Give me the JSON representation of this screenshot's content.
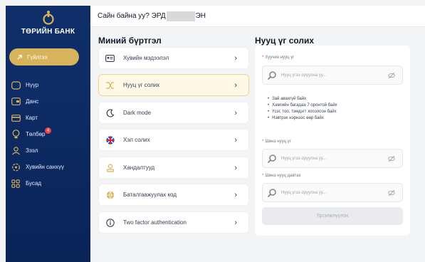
{
  "brand": {
    "title": "ТӨРИЙН БАНК"
  },
  "sidebar": {
    "transfer_label": "Гүйлгээ",
    "items": [
      {
        "label": "Нүүр"
      },
      {
        "label": "Данс"
      },
      {
        "label": "Карт"
      },
      {
        "label": "Төлбөр",
        "badge": "4"
      },
      {
        "label": "Зээл"
      },
      {
        "label": "Хувийн санхүү"
      },
      {
        "label": "Бусад"
      }
    ]
  },
  "header": {
    "greeting_start": "Сайн байна уу? ЭРД",
    "greeting_end": "ЭН"
  },
  "profile": {
    "title": "Миний бүртгэл",
    "menu": [
      {
        "label": "Хувийн мэдээлэл"
      },
      {
        "label": "Нууц үг солих"
      },
      {
        "label": "Dark mode"
      },
      {
        "label": "Хэл солих"
      },
      {
        "label": "Хандалтууд"
      },
      {
        "label": "Баталгаажуулах код"
      },
      {
        "label": "Two factor authentication"
      }
    ]
  },
  "password": {
    "title": "Нууц үг солих",
    "current_label": "Хуучин нууц үг",
    "new_label": "Шинэ нууц үг",
    "repeat_label": "Шинэ нууц давтах",
    "placeholder": "Нууц үгээ оруулна уу...",
    "rules": [
      "Зай авахгүй байх",
      "Хамгийн багадаа 7 оронтой байх",
      "Үсэг, тоо, тэмдэгт хосолсон байх",
      "Нэвтрэх нэрнээс өөр байх"
    ],
    "submit_label": "Үргэлжлүүлэх"
  },
  "colors": {
    "sidebar": "#0f2f6b",
    "accent_gold": "#d7b35b",
    "active_card": "#fff8e7"
  }
}
